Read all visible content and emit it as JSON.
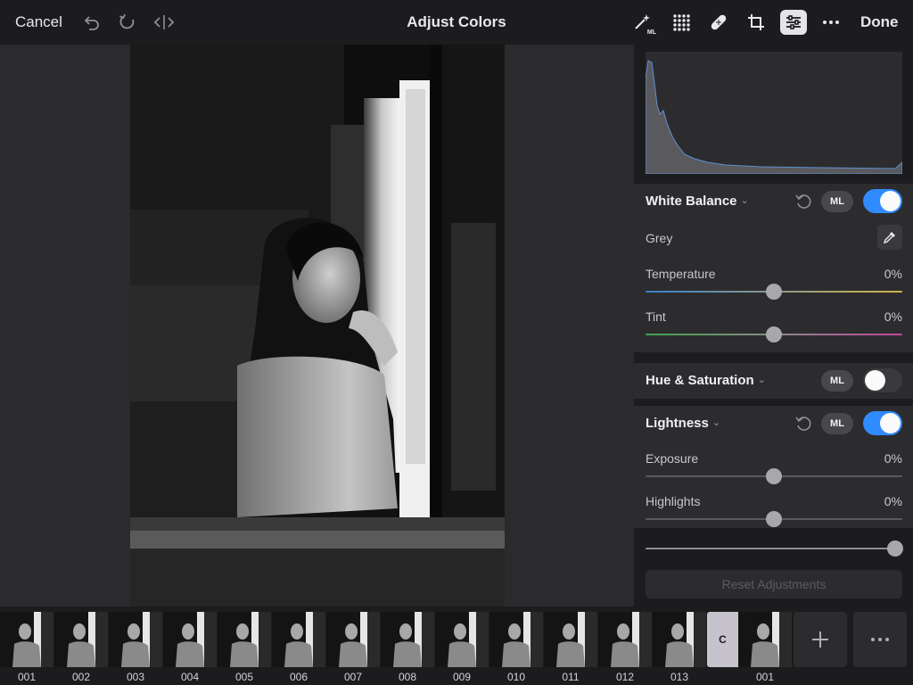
{
  "topbar": {
    "cancel_label": "Cancel",
    "title": "Adjust Colors",
    "done_label": "Done",
    "icons": [
      "undo-icon",
      "redo-icon",
      "compare-icon",
      "ml-wand-icon",
      "presets-grid-icon",
      "heal-bandage-icon",
      "crop-icon",
      "adjust-sliders-icon",
      "more-icon"
    ]
  },
  "colors": {
    "accent": "#2f8bff",
    "panel_bg": "#2c2c2e",
    "app_bg": "#1c1c1e"
  },
  "white_balance": {
    "title": "White Balance",
    "ml_label": "ML",
    "enabled": true,
    "grey_label": "Grey",
    "temperature_label": "Temperature",
    "temperature_value": "0%",
    "tint_label": "Tint",
    "tint_value": "0%"
  },
  "hue_saturation": {
    "title": "Hue & Saturation",
    "ml_label": "ML",
    "enabled": false
  },
  "lightness": {
    "title": "Lightness",
    "ml_label": "ML",
    "enabled": true,
    "exposure_label": "Exposure",
    "exposure_value": "0%",
    "highlights_label": "Highlights",
    "highlights_value": "0%"
  },
  "reset_label": "Reset Adjustments",
  "filmstrip": {
    "thumbnails": [
      "001",
      "002",
      "003",
      "004",
      "005",
      "006",
      "007",
      "008",
      "009",
      "010",
      "011",
      "012",
      "013"
    ],
    "copy_label": "C",
    "copy_thumb_label": "001"
  }
}
